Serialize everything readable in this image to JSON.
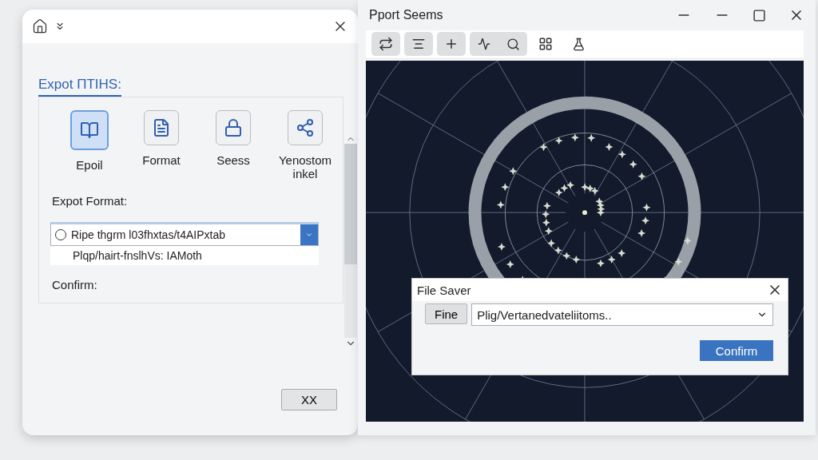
{
  "export_dialog": {
    "section_title": "Expot ΠTIHS:",
    "format_tiles": [
      {
        "label": "Epoil",
        "selected": true,
        "kind": "book"
      },
      {
        "label": "Format",
        "selected": false,
        "kind": "document"
      },
      {
        "label": "Seess",
        "selected": false,
        "kind": "lock"
      },
      {
        "label": "Yenostom inkel",
        "selected": false,
        "kind": "network"
      }
    ],
    "format_label": "Expot Format:",
    "format_select": {
      "value": "Ripe thgrm l03fhxtas/t4AIPxtab",
      "checked": false,
      "option": "Plqp/hairt-fnslhVs: IAMoth"
    },
    "confirm_label": "Confirm:",
    "ok_button": "XX"
  },
  "viewer_window": {
    "title": "Pport Seems",
    "file_saver": {
      "title": "File Saver",
      "browse_button": "Fine",
      "path": "Plig/Vertanedvateliitoms..",
      "confirm_button": "Confirm"
    }
  }
}
